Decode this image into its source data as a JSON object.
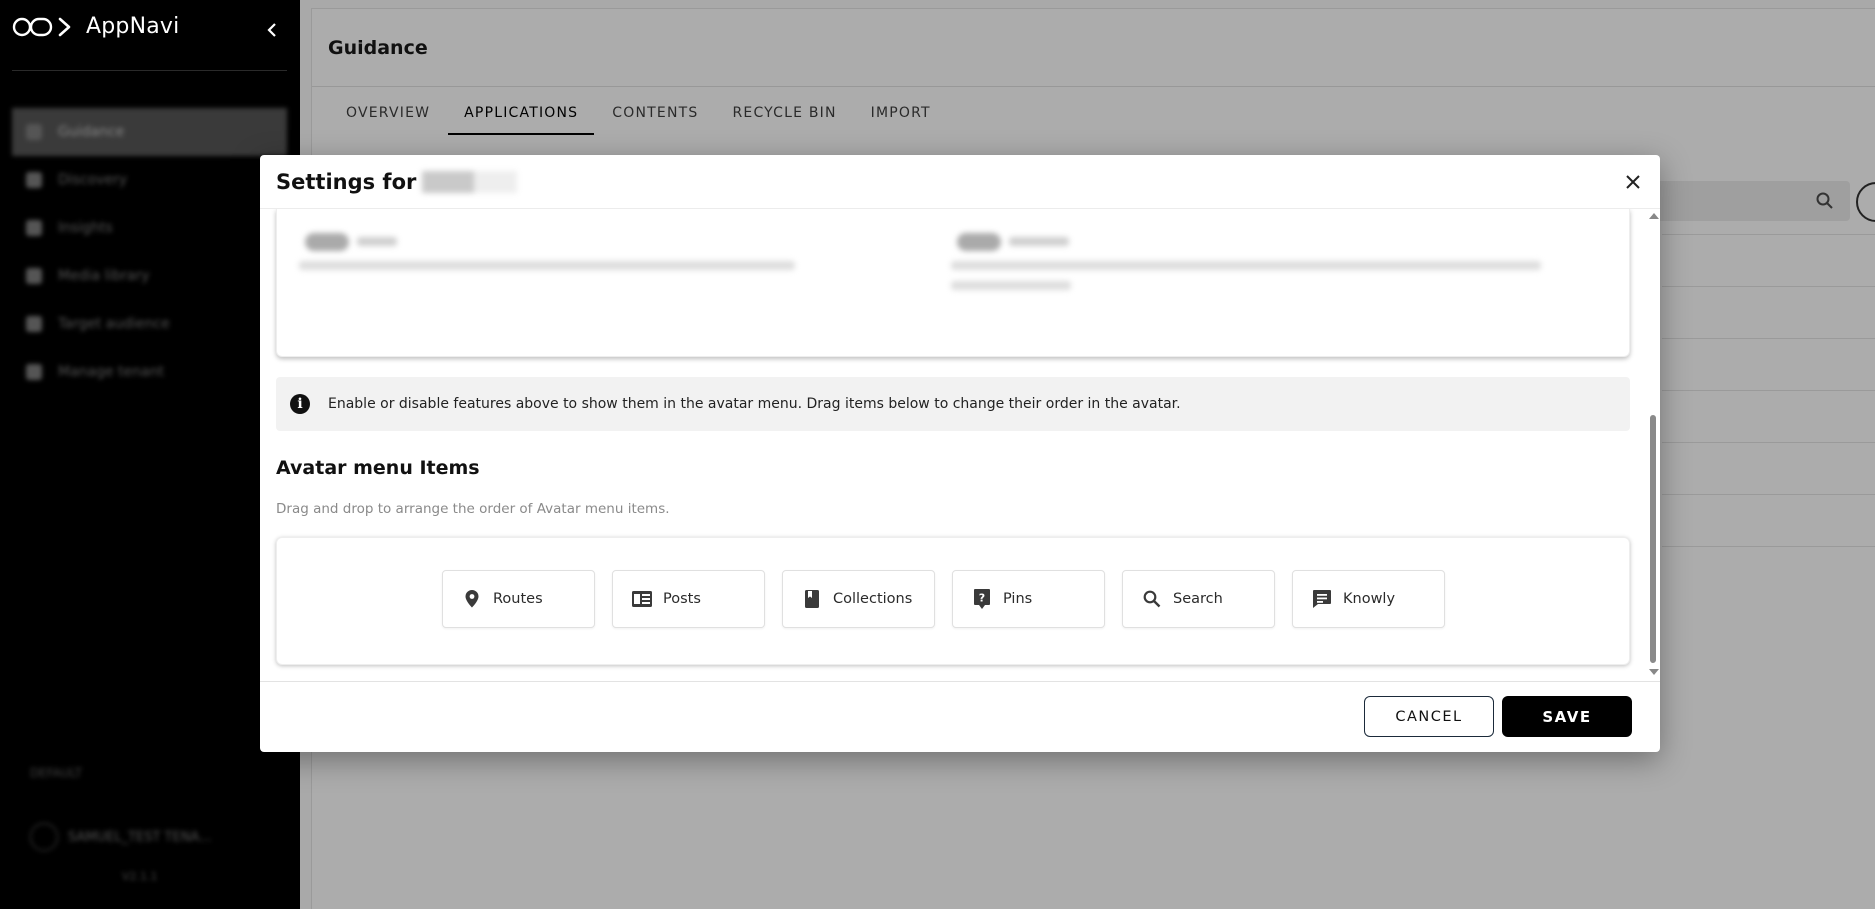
{
  "app": {
    "brand_name": "AppNavi"
  },
  "sidebar": {
    "items": [
      {
        "label": "Guidance"
      },
      {
        "label": "Discovery"
      },
      {
        "label": "Insights"
      },
      {
        "label": "Media library"
      },
      {
        "label": "Target audience"
      },
      {
        "label": "Manage tenant"
      }
    ],
    "footer_label": "DEFAULT",
    "footer_user": "SAMUEL_TEST TENA...",
    "footer_version": "V2.1.1"
  },
  "main": {
    "title": "Guidance",
    "tabs": [
      {
        "label": "OVERVIEW"
      },
      {
        "label": "APPLICATIONS",
        "active": true
      },
      {
        "label": "CONTENTS"
      },
      {
        "label": "RECYCLE BIN"
      },
      {
        "label": "IMPORT"
      }
    ]
  },
  "dialog": {
    "title": "Settings for",
    "info_text": "Enable or disable features above to show them in the avatar menu. Drag items below to change their order in the avatar.",
    "section_title": "Avatar menu Items",
    "section_subtitle": "Drag and drop to arrange the order of Avatar menu items.",
    "menu_items": [
      {
        "label": "Routes",
        "icon": "location-pin-icon"
      },
      {
        "label": "Posts",
        "icon": "newspaper-icon"
      },
      {
        "label": "Collections",
        "icon": "book-icon"
      },
      {
        "label": "Pins",
        "icon": "help-pin-icon"
      },
      {
        "label": "Search",
        "icon": "search-icon"
      },
      {
        "label": "Knowly",
        "icon": "chat-icon"
      }
    ],
    "cancel_label": "CANCEL",
    "save_label": "SAVE"
  },
  "colors": {
    "accent": "#000000",
    "overlay": "#a9a9a9"
  }
}
